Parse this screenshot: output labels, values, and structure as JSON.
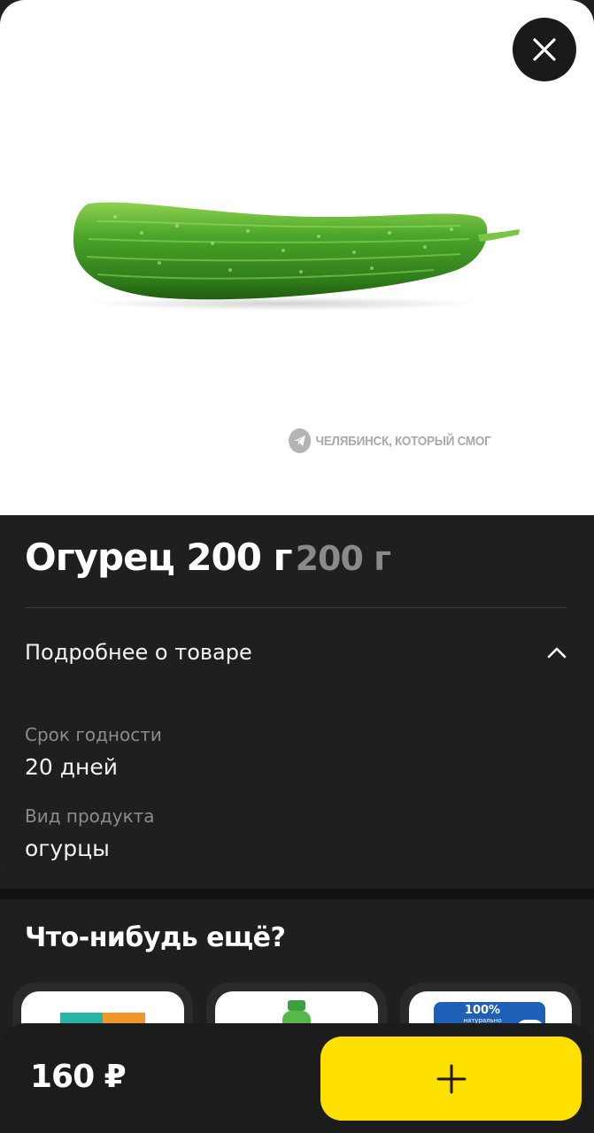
{
  "product": {
    "title": "Огурец 200 г",
    "weight": "200 г",
    "image_icon": "cucumber-image"
  },
  "watermark": {
    "text": "ЧЕЛЯБИНСК, КОТОРЫЙ СМОГ",
    "icon": "telegram-icon"
  },
  "close_icon": "close-icon",
  "details": {
    "label": "Подробнее о товаре",
    "toggle_icon": "chevron-up-icon",
    "attributes": [
      {
        "label": "Срок годности",
        "value": "20 дней"
      },
      {
        "label": "Вид продукта",
        "value": "огурцы"
      }
    ]
  },
  "recommendations": {
    "title": "Что-нибудь ещё?",
    "cards": [
      {
        "icon": "product-package-icon"
      },
      {
        "icon": "bottle-icon"
      },
      {
        "icon": "dairy-pack-icon",
        "badge": "100%",
        "badge_sub": "натурально",
        "size": "200"
      }
    ]
  },
  "cart": {
    "price": "160 ₽",
    "add_icon": "plus-icon"
  },
  "colors": {
    "accent": "#fde000",
    "background": "#1f1f1f",
    "muted_text": "#8c8c8c"
  }
}
